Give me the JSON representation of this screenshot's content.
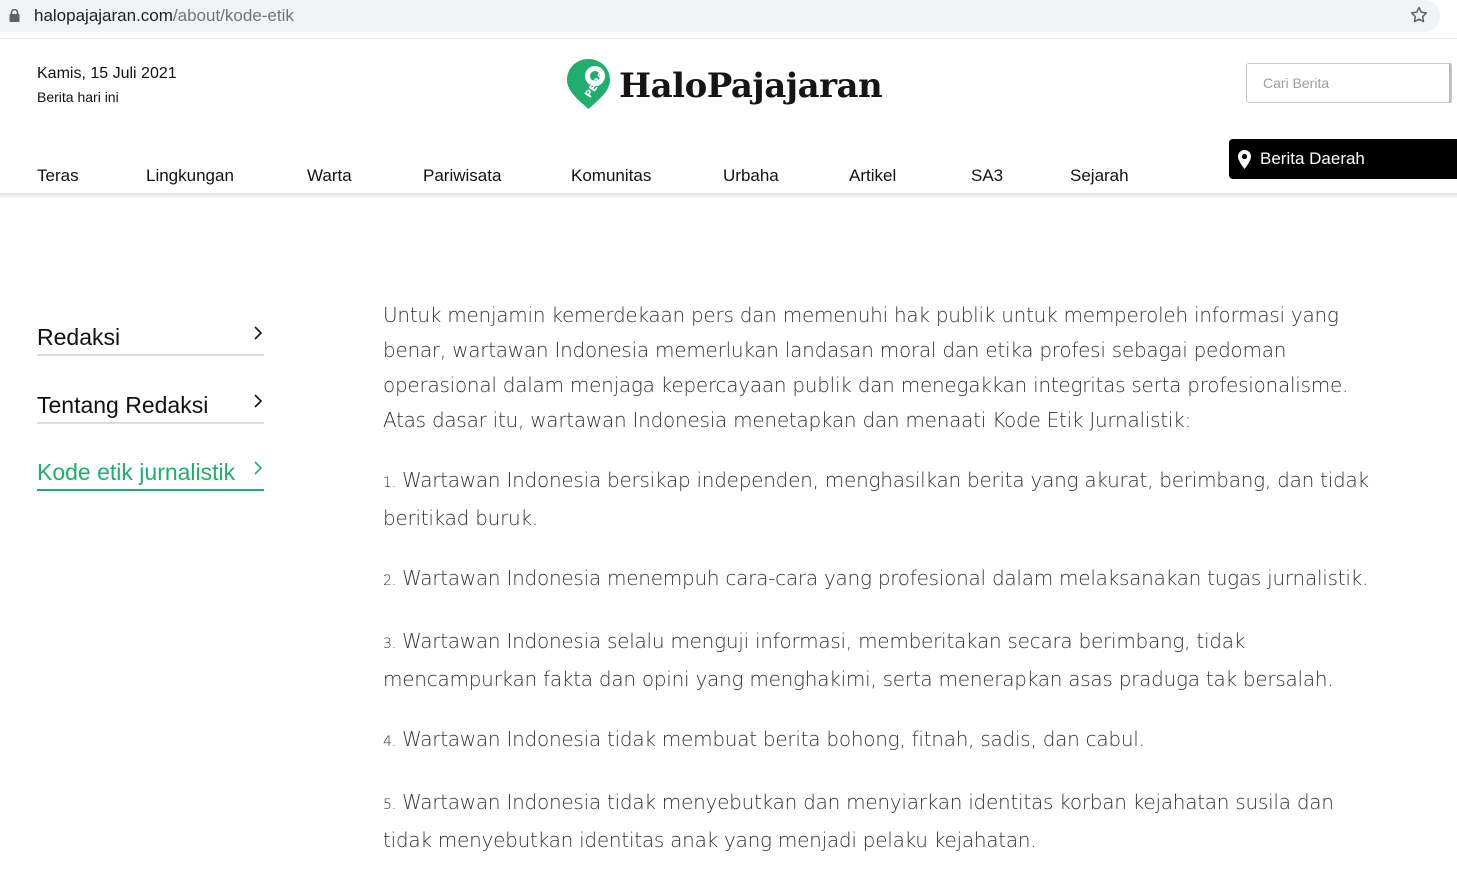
{
  "browser": {
    "url_host": "halopajajaran.com",
    "url_path": "/about/kode-etik"
  },
  "header": {
    "date": "Kamis, 15 Juli 2021",
    "date_sub": "Berita hari ini",
    "logo_badge": "PERS",
    "logo_text": "HaloPajajaran",
    "search_placeholder": "Cari Berita"
  },
  "nav": {
    "items": [
      "Teras",
      "Lingkungan",
      "Warta",
      "Pariwisata",
      "Komunitas",
      "Urbaha",
      "Artikel",
      "SA3",
      "Sejarah"
    ],
    "region_button": "Berita Daerah"
  },
  "sidebar": {
    "items": [
      {
        "label": "Redaksi",
        "active": false
      },
      {
        "label": "Tentang Redaksi",
        "active": false
      },
      {
        "label": "Kode etik jurnalistik",
        "active": true
      }
    ]
  },
  "content": {
    "intro": "Untuk menjamin kemerdekaan pers dan memenuhi hak publik untuk memperoleh informasi yang benar, wartawan Indonesia memerlukan landasan moral dan etika profesi sebagai pedoman operasional dalam menjaga kepercayaan publik dan menegakkan integritas serta profesionalisme. Atas dasar itu, wartawan Indonesia menetapkan dan menaati Kode Etik Jurnalistik:",
    "points": [
      {
        "num": "1.",
        "text": "Wartawan Indonesia bersikap independen, menghasilkan berita yang akurat, berimbang, dan tidak beritikad buruk."
      },
      {
        "num": "2.",
        "text": "Wartawan Indonesia menempuh cara-cara yang profesional dalam melaksanakan tugas jurnalistik."
      },
      {
        "num": "3.",
        "text": "Wartawan Indonesia selalu menguji informasi, memberitakan secara berimbang, tidak mencampurkan fakta dan opini yang menghakimi, serta menerapkan asas praduga tak bersalah."
      },
      {
        "num": "4.",
        "text": "Wartawan Indonesia tidak membuat berita bohong, fitnah, sadis, dan cabul."
      },
      {
        "num": "5.",
        "text": "Wartawan Indonesia tidak menyebutkan dan menyiarkan identitas korban kejahatan susila dan tidak menyebutkan identitas anak yang menjadi pelaku kejahatan."
      }
    ]
  },
  "colors": {
    "accent": "#1fae6d",
    "nav_button_bg": "#000000"
  },
  "icons": {
    "lock": "lock-icon",
    "star": "bookmark-star-icon",
    "region": "map-pin-icon",
    "chevron": "chevron-right-icon"
  }
}
